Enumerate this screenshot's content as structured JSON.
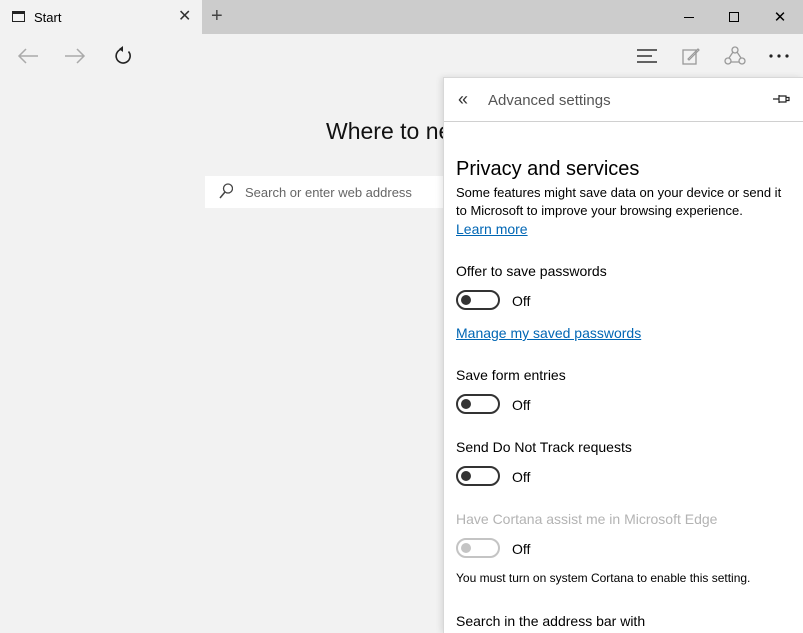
{
  "browser": {
    "tab_title": "Start",
    "tab_close": "✕",
    "new_tab": "+",
    "window_close": "✕"
  },
  "start_page": {
    "heading": "Where to next?",
    "search_placeholder": "Search or enter web address"
  },
  "panel": {
    "back_glyph": "«",
    "title": "Advanced settings",
    "section_title": "Privacy and services",
    "description": "Some features might save data on your device or send it to Microsoft to improve your browsing experience.",
    "learn_more": "Learn more",
    "offer_passwords": {
      "label": "Offer to save passwords",
      "state": "Off"
    },
    "manage_passwords": "Manage my saved passwords",
    "form_entries": {
      "label": "Save form entries",
      "state": "Off"
    },
    "do_not_track": {
      "label": "Send Do Not Track requests",
      "state": "Off"
    },
    "cortana": {
      "label": "Have Cortana assist me in Microsoft Edge",
      "state": "Off"
    },
    "cortana_note": "You must turn on system Cortana to enable this setting.",
    "search_with": "Search in the address bar with"
  },
  "colors": {
    "link": "#0066b4",
    "chrome": "#cccccc",
    "page_bg": "#f2f2f2",
    "disabled": "#b3b3b3"
  }
}
